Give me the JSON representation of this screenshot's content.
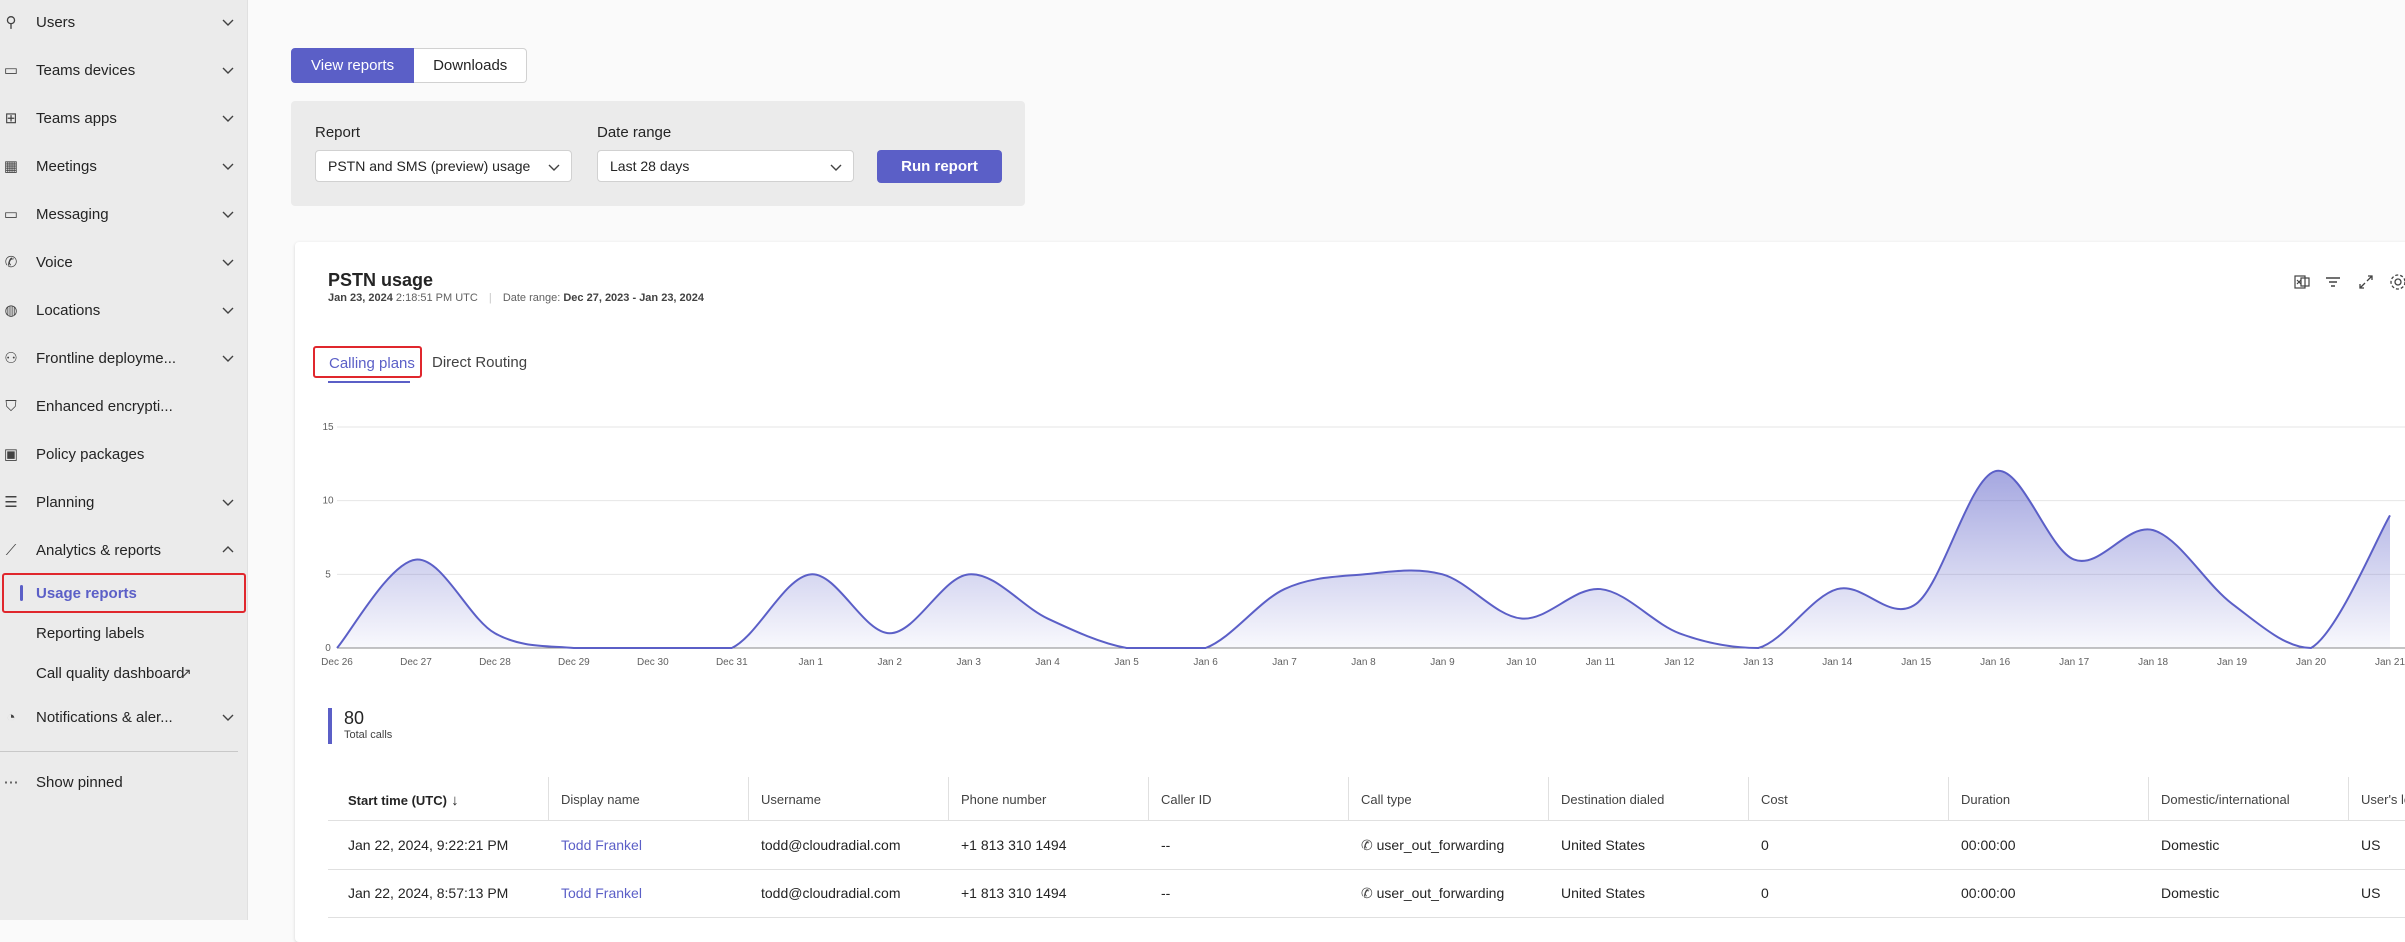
{
  "sidebar": {
    "items": [
      {
        "label": "Users",
        "icon": "users-icon",
        "chevron": "down"
      },
      {
        "label": "Teams devices",
        "icon": "devices-icon",
        "chevron": "down"
      },
      {
        "label": "Teams apps",
        "icon": "apps-icon",
        "chevron": "down"
      },
      {
        "label": "Meetings",
        "icon": "calendar-icon",
        "chevron": "down"
      },
      {
        "label": "Messaging",
        "icon": "chat-icon",
        "chevron": "down"
      },
      {
        "label": "Voice",
        "icon": "phone-icon",
        "chevron": "down"
      },
      {
        "label": "Locations",
        "icon": "globe-icon",
        "chevron": "down"
      },
      {
        "label": "Frontline deployme...",
        "icon": "people-group-icon",
        "chevron": "down"
      },
      {
        "label": "Enhanced encrypti...",
        "icon": "shield-icon",
        "chevron": ""
      },
      {
        "label": "Policy packages",
        "icon": "package-icon",
        "chevron": ""
      },
      {
        "label": "Planning",
        "icon": "list-icon",
        "chevron": "down"
      },
      {
        "label": "Analytics & reports",
        "icon": "analytics-icon",
        "chevron": "up"
      }
    ],
    "subitems": [
      {
        "label": "Usage reports",
        "active": true
      },
      {
        "label": "Reporting labels",
        "active": false
      },
      {
        "label": "Call quality dashboard",
        "active": false,
        "external": true
      }
    ],
    "bottom": [
      {
        "label": "Notifications & aler...",
        "icon": "bell-icon",
        "chevron": "down"
      },
      {
        "label": "Show pinned",
        "icon": "more-icon",
        "chevron": ""
      }
    ]
  },
  "tabs": {
    "view": "View reports",
    "downloads": "Downloads"
  },
  "filter": {
    "report_label": "Report",
    "report_value": "PSTN and SMS (preview) usage",
    "date_label": "Date range",
    "date_value": "Last 28 days",
    "run_label": "Run report"
  },
  "card": {
    "title": "PSTN usage",
    "timestamp_date": "Jan 23, 2024",
    "timestamp_time": "2:18:51 PM UTC",
    "range_label": "Date range:",
    "range_value": "Dec 27, 2023 - Jan 23, 2024",
    "tab_calling": "Calling plans",
    "tab_direct": "Direct Routing"
  },
  "accent": "#5b5fc7",
  "chart_data": {
    "type": "area",
    "x": [
      "Dec 26",
      "Dec 27",
      "Dec 28",
      "Dec 29",
      "Dec 30",
      "Dec 31",
      "Jan 1",
      "Jan 2",
      "Jan 3",
      "Jan 4",
      "Jan 5",
      "Jan 6",
      "Jan 7",
      "Jan 8",
      "Jan 9",
      "Jan 10",
      "Jan 11",
      "Jan 12",
      "Jan 13",
      "Jan 14",
      "Jan 15",
      "Jan 16",
      "Jan 17",
      "Jan 18",
      "Jan 19",
      "Jan 20",
      "Jan 21"
    ],
    "values": [
      0,
      6,
      1,
      0,
      0,
      0,
      5,
      1,
      5,
      2,
      0,
      0,
      4,
      5,
      5,
      2,
      4,
      1,
      0,
      4,
      3,
      12,
      6,
      8,
      3,
      0,
      9
    ],
    "yticks": [
      0,
      5,
      10,
      15
    ],
    "ylim": [
      0,
      15
    ],
    "grid": true
  },
  "kpi": {
    "value": "80",
    "label": "Total calls"
  },
  "table": {
    "columns": [
      "Start time (UTC)",
      "Display name",
      "Username",
      "Phone number",
      "Caller ID",
      "Call type",
      "Destination dialed",
      "Cost",
      "Duration",
      "Domestic/international",
      "User's lo"
    ],
    "rows": [
      [
        "Jan 22, 2024, 9:22:21 PM",
        "Todd Frankel",
        "todd@cloudradial.com",
        "+1 813 310 1494",
        "--",
        "user_out_forwarding",
        "United States",
        "0",
        "00:00:00",
        "Domestic",
        "US"
      ],
      [
        "Jan 22, 2024, 8:57:13 PM",
        "Todd Frankel",
        "todd@cloudradial.com",
        "+1 813 310 1494",
        "--",
        "user_out_forwarding",
        "United States",
        "0",
        "00:00:00",
        "Domestic",
        "US"
      ]
    ]
  }
}
